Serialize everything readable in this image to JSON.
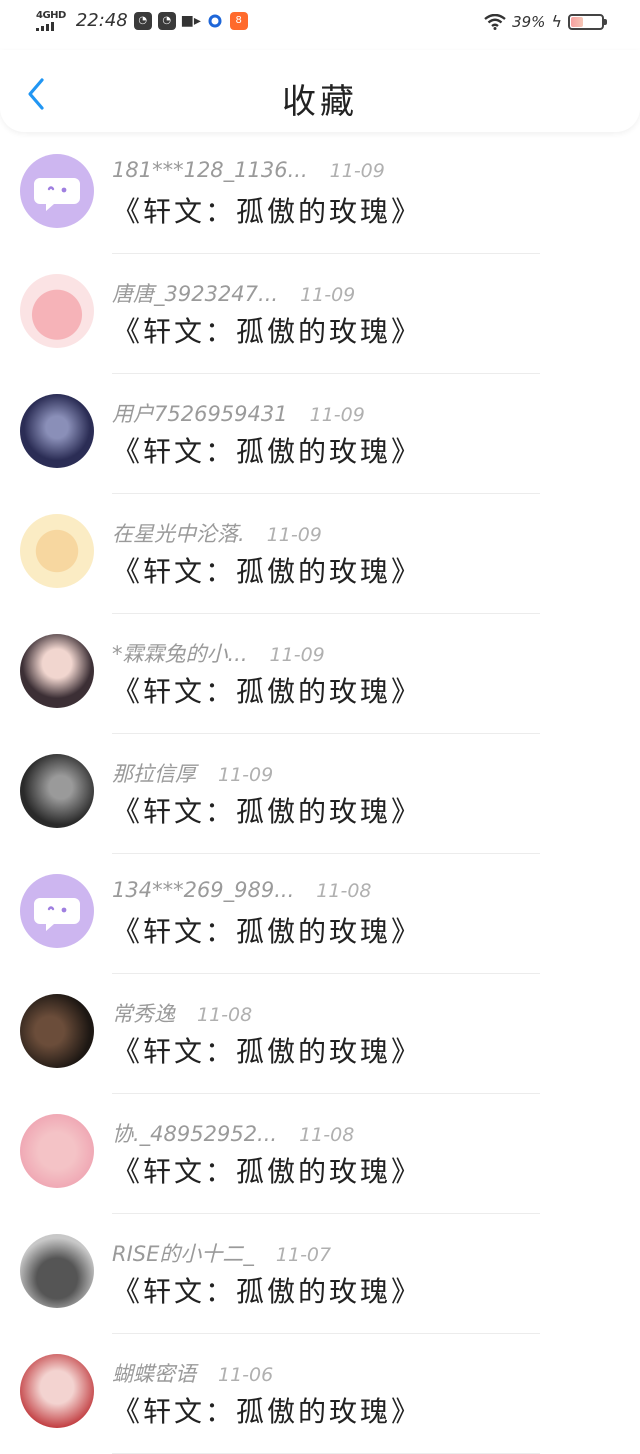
{
  "status_bar": {
    "network": "4GHD",
    "time": "22:48",
    "battery_percent": "39%",
    "battery_level": 0.39,
    "app_icons": [
      "qq-icon",
      "qq-icon",
      "video-icon",
      "circle-app-icon",
      "app-icon"
    ]
  },
  "header": {
    "title": "收藏",
    "back_icon": "chevron-left-icon",
    "accent": "#2196f3"
  },
  "items": [
    {
      "name": "181***128_1136...",
      "date": "11-09",
      "book": "《轩文：孤傲的玫瑰》",
      "avatar": "default"
    },
    {
      "name": "唐唐_3923247...",
      "date": "11-09",
      "book": "《轩文：孤傲的玫瑰》",
      "avatar": "pink"
    },
    {
      "name": "用户7526959431",
      "date": "11-09",
      "book": "《轩文：孤傲的玫瑰》",
      "avatar": "dark-blue"
    },
    {
      "name": "在星光中沦落.",
      "date": "11-09",
      "book": "《轩文：孤傲的玫瑰》",
      "avatar": "yellow"
    },
    {
      "name": "*霖霖兔的小...",
      "date": "11-09",
      "book": "《轩文：孤傲的玫瑰》",
      "avatar": "portrait"
    },
    {
      "name": "那拉信厚",
      "date": "11-09",
      "book": "《轩文：孤傲的玫瑰》",
      "avatar": "bw"
    },
    {
      "name": "134***269_989...",
      "date": "11-08",
      "book": "《轩文：孤傲的玫瑰》",
      "avatar": "default"
    },
    {
      "name": "常秀逸",
      "date": "11-08",
      "book": "《轩文：孤傲的玫瑰》",
      "avatar": "dark-brown"
    },
    {
      "name": "协._48952952...",
      "date": "11-08",
      "book": "《轩文：孤傲的玫瑰》",
      "avatar": "anime-pink"
    },
    {
      "name": "RISE的小十二_",
      "date": "11-07",
      "book": "《轩文：孤傲的玫瑰》",
      "avatar": "group"
    },
    {
      "name": "蝴蝶密语",
      "date": "11-06",
      "book": "《轩文：孤傲的玫瑰》",
      "avatar": "anime-red"
    }
  ]
}
